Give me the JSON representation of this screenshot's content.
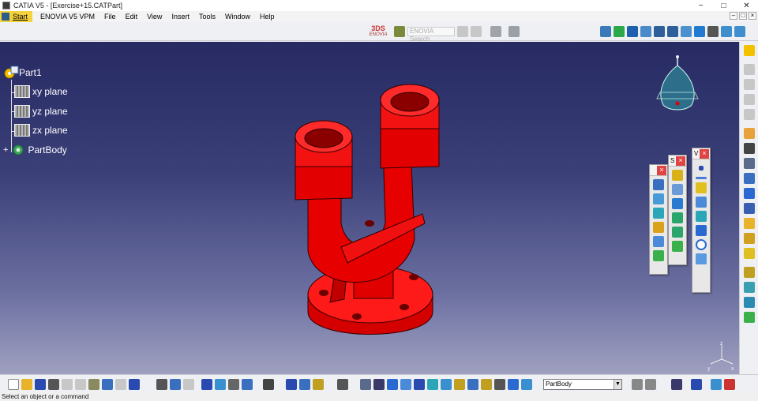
{
  "window": {
    "title": "CATIA V5 - [Exercise+15.CATPart]",
    "controls": [
      "−",
      "□",
      "✕"
    ]
  },
  "menu": {
    "start": "Start",
    "items": [
      "ENOVIA V5 VPM",
      "File",
      "Edit",
      "View",
      "Insert",
      "Tools",
      "Window",
      "Help"
    ],
    "mdi_controls": [
      "–",
      "□",
      "×"
    ]
  },
  "top_toolbar": {
    "enovia_logo": "ENOVIA",
    "enovia_mark": "3DS",
    "search_placeholder": "ENOVIA Search"
  },
  "tree": {
    "root": "Part1",
    "children": [
      "xy plane",
      "yz plane",
      "zx plane"
    ],
    "body": "PartBody"
  },
  "floating_toolbars": [
    {
      "title": "",
      "close": "×"
    },
    {
      "title": "S",
      "close": "×"
    },
    {
      "title": "V",
      "close": "×"
    }
  ],
  "axes": {
    "x": "x",
    "y": "y",
    "z": "z"
  },
  "current_body": "PartBody",
  "status": "Select an object or a command",
  "colors": {
    "part": "#e00000",
    "background_top": "#272a63",
    "background_bottom": "#9fa0c0",
    "compass": "#2d6e8a"
  }
}
